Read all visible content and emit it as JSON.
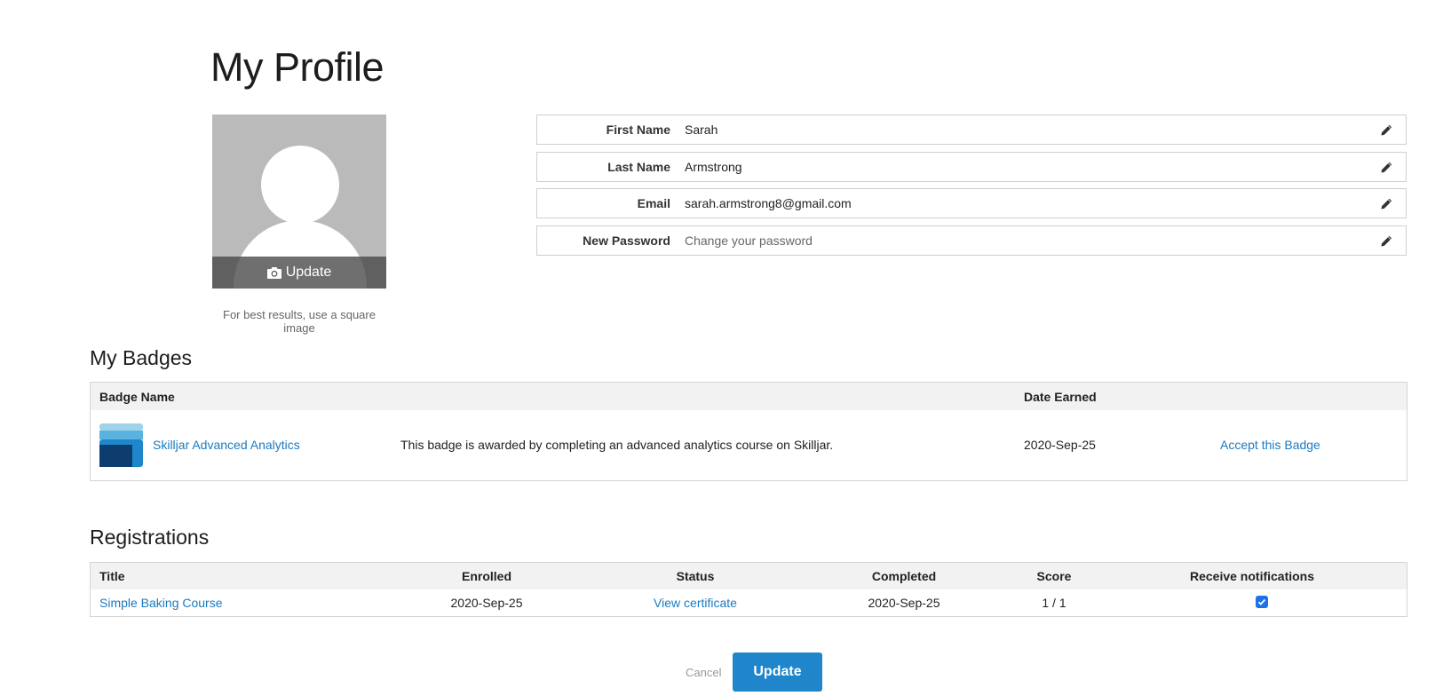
{
  "page": {
    "title": "My Profile"
  },
  "avatar": {
    "update_label": "Update",
    "camera_icon": "camera-icon",
    "hint": "For best results, use a square image"
  },
  "profile_fields": [
    {
      "label": "First Name",
      "value": "Sarah"
    },
    {
      "label": "Last Name",
      "value": "Armstrong"
    },
    {
      "label": "Email",
      "value": "sarah.armstrong8@gmail.com"
    },
    {
      "label": "New Password",
      "value": "Change your password"
    }
  ],
  "badges": {
    "title": "My Badges",
    "columns": {
      "name": "Badge Name",
      "date": "Date Earned"
    },
    "rows": [
      {
        "name": "Skilljar Advanced Analytics",
        "description": "This badge is awarded by completing an advanced analytics course on Skilljar.",
        "date": "2020-Sep-25",
        "action": "Accept this Badge"
      }
    ]
  },
  "registrations": {
    "title": "Registrations",
    "columns": [
      "Title",
      "Enrolled",
      "Status",
      "Completed",
      "Score",
      "Receive notifications"
    ],
    "rows": [
      {
        "title": "Simple Baking Course",
        "enrolled": "2020-Sep-25",
        "status": "View certificate",
        "completed": "2020-Sep-25",
        "score": "1 / 1",
        "notifications": true
      }
    ]
  },
  "actions": {
    "cancel_label": "Cancel",
    "update_label": "Update"
  },
  "colors": {
    "link": "#1a7bc1",
    "primary_button": "#1f86cc",
    "header_bg": "#f2f2f2"
  }
}
